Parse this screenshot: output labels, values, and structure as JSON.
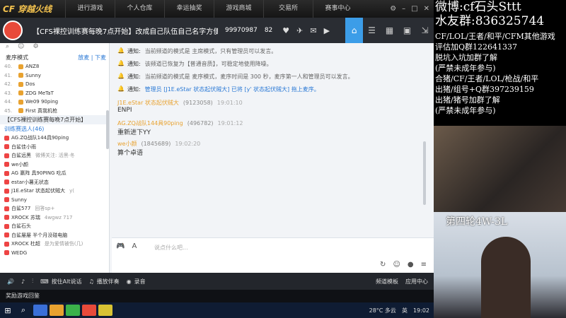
{
  "topbar": {
    "logo": "CF 穿越火线",
    "nav": [
      "进行游戏",
      "个人仓库",
      "幸运抽奖",
      "游戏商城",
      "交易所",
      "赛事中心"
    ]
  },
  "room": {
    "title": "【CFS裸控训练赛每晚7点开始】改成自己队伍自己名字方便发...",
    "id": "99970987",
    "count": "82"
  },
  "left": {
    "mode": "麦序模式",
    "mode_links": [
      "放麦",
      "下麦"
    ],
    "users": [
      {
        "num": "40.",
        "name": "ANZ8"
      },
      {
        "num": "41.",
        "name": "Sunny"
      },
      {
        "num": "42.",
        "name": "Dos"
      },
      {
        "num": "43.",
        "name": "ZDG MeTaT"
      },
      {
        "num": "44.",
        "name": "We09 90ping"
      },
      {
        "num": "45.",
        "name": "First 真我机枪"
      }
    ],
    "group_title": "【CFS裸控训练赛每晚7点开始】",
    "group_sub": "训练赛选人(46)",
    "members": [
      {
        "name": "AG.ZQ战队144具90ping",
        "extra": ""
      },
      {
        "name": "白鲨佳小雨",
        "extra": ""
      },
      {
        "name": "白鲨远黑",
        "extra": "微博关注: 活黑·冬"
      },
      {
        "name": "we小颜",
        "extra": ""
      },
      {
        "name": "AG 赢阵 具90PING 吃瓜",
        "extra": ""
      },
      {
        "name": "estar小薯无状态",
        "extra": ""
      },
      {
        "name": "J1E.eStar 状态起伏贼大",
        "extra": "y("
      },
      {
        "name": "Sunny",
        "extra": ""
      },
      {
        "name": "白鲨577",
        "extra": "回答sp+"
      },
      {
        "name": "XROCK 苏瑞",
        "extra": "4wgwz 717"
      },
      {
        "name": "白鲨石头",
        "extra": ""
      },
      {
        "name": "白鲨屡屡 半个月没碰电脑",
        "extra": ""
      },
      {
        "name": "XROCK 杜超",
        "extra": "是为爱情被伤(几)"
      },
      {
        "name": "WEDG",
        "extra": ""
      }
    ]
  },
  "notices": [
    {
      "k": "通知:",
      "text": "当前频道的模式是 主席模式，只有管理员可以发言。"
    },
    {
      "k": "通知:",
      "text": "该频道已恢复为【普通音质】，可稳定地使用降噪。"
    },
    {
      "k": "通知:",
      "text": "当前频道的模式是 麦序模式，麦序时间是 300 秒，麦序第一人和管理员可以发言。"
    },
    {
      "k": "通知:",
      "text": "管理员 [J1E.eStar 状态起伏贼大] 已将 [y' 状态起伏贼大] 拖上麦序。"
    }
  ],
  "chats": [
    {
      "user": "J1E.eStar 状态起伏贼大",
      "id": "(9123058)",
      "time": "19:01:10",
      "text": "ENPI"
    },
    {
      "user": "AG.ZQ战队144具90ping",
      "id": "(496782)",
      "time": "19:01:12",
      "text": "重新进下YY"
    },
    {
      "user": "we小颜",
      "id": "(1845689)",
      "time": "19:02:20",
      "text": "算个卓语"
    }
  ],
  "input": {
    "placeholder": "说点什么吧..."
  },
  "toolbar": {
    "items": [
      "按住Alt说话",
      "播放伴奏",
      "录音"
    ],
    "right": [
      "频道模板",
      "应用中心"
    ]
  },
  "strip": "奖励游戏回鉴",
  "taskbar": {
    "weather": "28°C 多云",
    "lang": "英",
    "time": "19:02"
  },
  "overlay": {
    "lines_big": [
      "微博:cf石头Sttt",
      "水友群:836325744"
    ],
    "lines_mid": [
      "CF/LOL/王者/和平/CFM其他游戏",
      "评估加Q群122641337",
      "脱坑入坑加群了解",
      "(严禁未成年参与)",
      "合猪/CF/王者/LOL/枪战/和平",
      "出猪/组号+Q群397239159",
      "出猪/猪号加群了解",
      "(严禁未成年参与)"
    ],
    "round": "第四轮4W-3L"
  }
}
